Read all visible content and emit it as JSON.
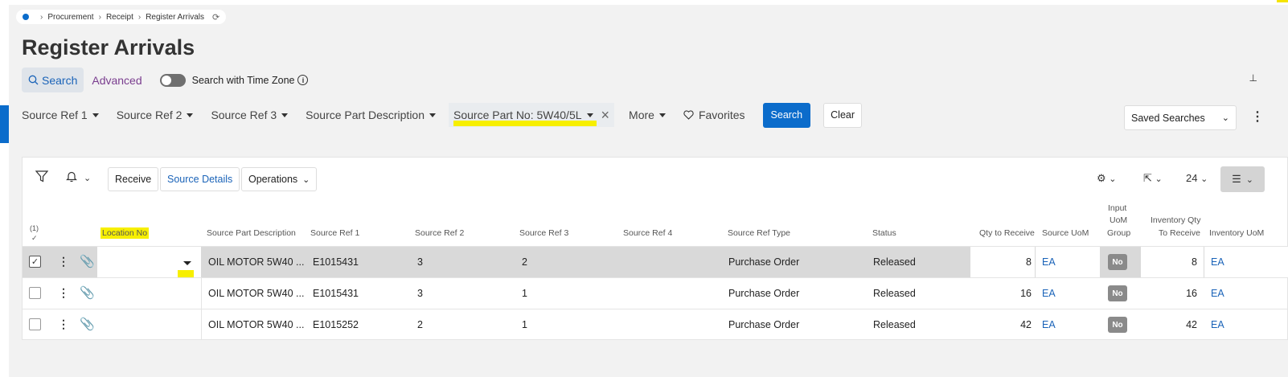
{
  "breadcrumb": {
    "items": [
      "Procurement",
      "Receipt",
      "Register Arrivals"
    ]
  },
  "page": {
    "title": "Register Arrivals"
  },
  "search_tabs": {
    "search": "Search",
    "advanced": "Advanced",
    "toggle_label": "Search with Time Zone"
  },
  "filters": {
    "items": [
      "Source Ref 1",
      "Source Ref 2",
      "Source Ref 3",
      "Source Part Description"
    ],
    "active": "Source Part No: 5W40/5L",
    "more": "More",
    "favorites": "Favorites",
    "search_button": "Search",
    "clear_button": "Clear",
    "saved_searches": "Saved Searches"
  },
  "toolbar": {
    "receive": "Receive",
    "source_details": "Source Details",
    "operations": "Operations",
    "page_size": "24"
  },
  "table": {
    "selected_count": "(1)",
    "headers": {
      "location_no": "Location No",
      "source_part_description": "Source Part Description",
      "source_ref_1": "Source Ref 1",
      "source_ref_2": "Source Ref 2",
      "source_ref_3": "Source Ref 3",
      "source_ref_4": "Source Ref 4",
      "source_ref_type": "Source Ref Type",
      "status": "Status",
      "qty_to_receive": "Qty to Receive",
      "source_uom": "Source UoM",
      "input_uom_group_1": "Input",
      "input_uom_group_2": "UoM",
      "input_uom_group_3": "Group",
      "inventory_qty_1": "Inventory Qty",
      "inventory_qty_2": "To Receive",
      "inventory_uom": "Inventory UoM"
    },
    "rows": [
      {
        "desc": "OIL MOTOR 5W40 ...",
        "ref1": "E1015431",
        "ref2": "3",
        "ref3": "2",
        "type": "Purchase Order",
        "status": "Released",
        "qty": "8",
        "uom": "EA",
        "group": "No",
        "inv_qty": "8",
        "inv_uom": "EA"
      },
      {
        "desc": "OIL MOTOR 5W40 ...",
        "ref1": "E1015431",
        "ref2": "3",
        "ref3": "1",
        "type": "Purchase Order",
        "status": "Released",
        "qty": "16",
        "uom": "EA",
        "group": "No",
        "inv_qty": "16",
        "inv_uom": "EA"
      },
      {
        "desc": "OIL MOTOR 5W40 ...",
        "ref1": "E1015252",
        "ref2": "2",
        "ref3": "1",
        "type": "Purchase Order",
        "status": "Released",
        "qty": "42",
        "uom": "EA",
        "group": "No",
        "inv_qty": "42",
        "inv_uom": "EA"
      }
    ]
  },
  "colors": {
    "accent": "#0b6ccb",
    "highlight": "#f7ef00",
    "link": "#1a63b8",
    "selected_row": "#d9d9d9"
  }
}
